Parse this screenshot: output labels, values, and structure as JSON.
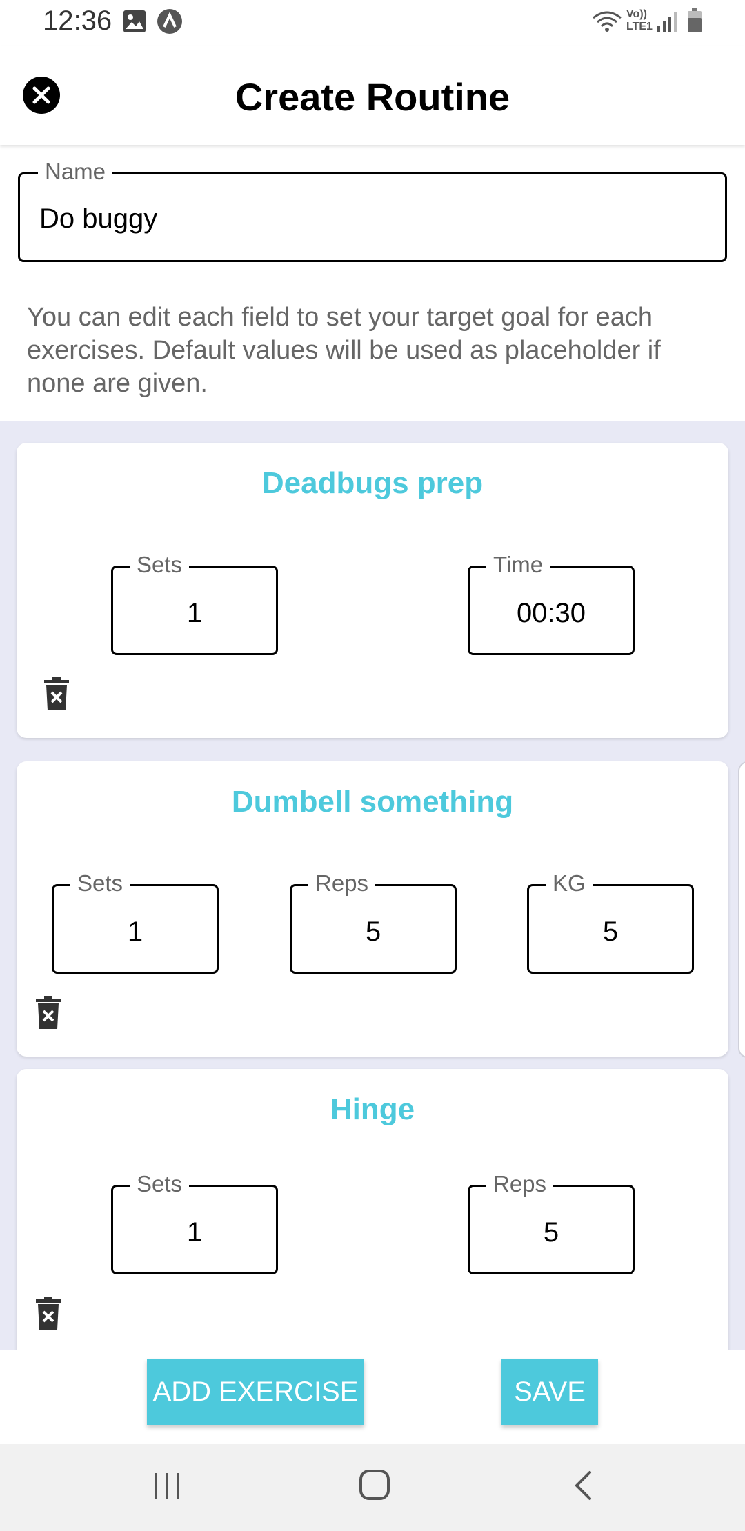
{
  "status_bar": {
    "time": "12:36",
    "icons": [
      "image-icon",
      "app-notification-icon",
      "wifi-icon",
      "volte-icon",
      "signal-icon",
      "battery-icon"
    ],
    "volte_line1": "Vo))",
    "volte_line2": "LTE1"
  },
  "header": {
    "title": "Create Routine",
    "close_icon": "close-circle-icon"
  },
  "name_field": {
    "label": "Name",
    "value": "Do buggy"
  },
  "helper_text": "You can edit each field to set your target goal for each exercises. Default values will be used as placeholder if none are given.",
  "exercises": [
    {
      "name": "Deadbugs prep",
      "fields": [
        {
          "label": "Sets",
          "value": "1"
        },
        {
          "label": "Time",
          "value": "00:30"
        }
      ]
    },
    {
      "name": "Dumbell something",
      "fields": [
        {
          "label": "Sets",
          "value": "1"
        },
        {
          "label": "Reps",
          "value": "5"
        },
        {
          "label": "KG",
          "value": "5"
        }
      ]
    },
    {
      "name": "Hinge",
      "fields": [
        {
          "label": "Sets",
          "value": "1"
        },
        {
          "label": "Reps",
          "value": "5"
        }
      ]
    }
  ],
  "actions": {
    "add_exercise": "ADD EXERCISE",
    "save": "SAVE"
  },
  "colors": {
    "accent": "#4dc9dc",
    "list_background": "#e8e9f5",
    "nav_background": "#f1f1f1"
  },
  "nav": [
    "recent-apps-icon",
    "home-icon",
    "back-icon"
  ]
}
